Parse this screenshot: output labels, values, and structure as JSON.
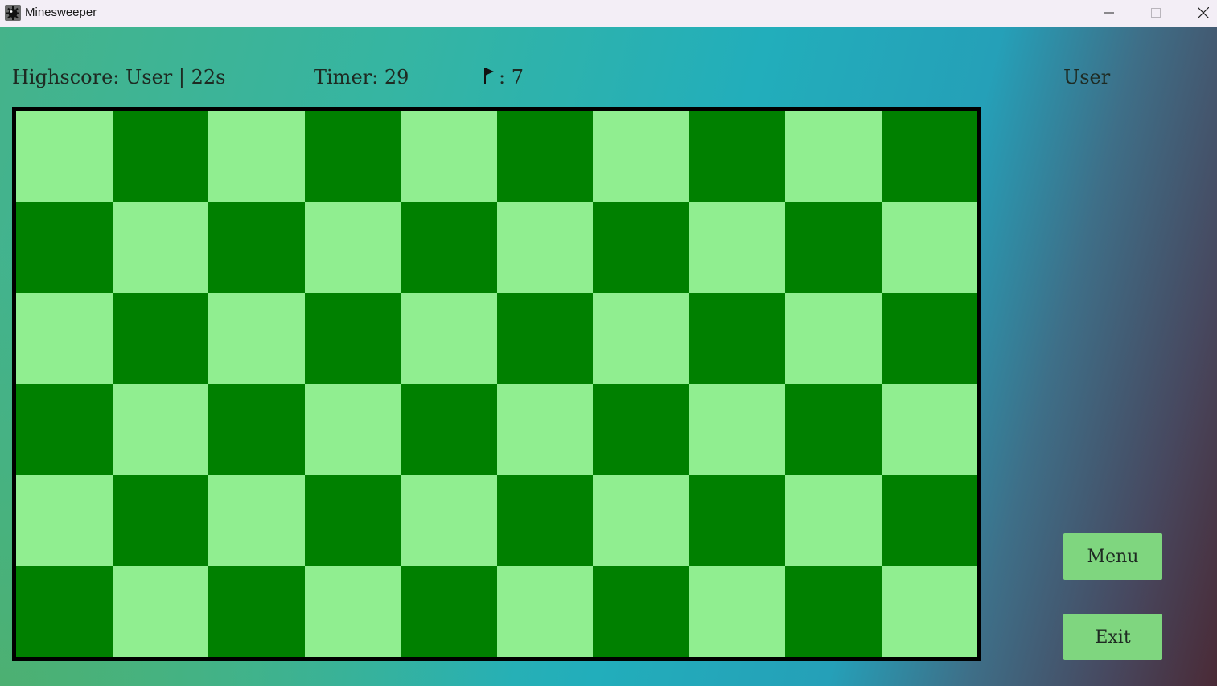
{
  "window": {
    "title": "Minesweeper",
    "icon": "mine-icon",
    "controls": [
      "minimize-icon",
      "maximize-icon",
      "close-icon"
    ]
  },
  "hud": {
    "highscore": "Highscore: User | 22s",
    "timer": "Timer: 29",
    "flags_icon": "flag-icon",
    "flags": ": 7",
    "username": "User"
  },
  "board": {
    "rows": 6,
    "cols": 10,
    "light_color": "#90ee90",
    "dark_color": "#008000",
    "border_color": "#000000"
  },
  "buttons": {
    "menu": "Menu",
    "exit": "Exit",
    "color": "#7fd67f"
  }
}
